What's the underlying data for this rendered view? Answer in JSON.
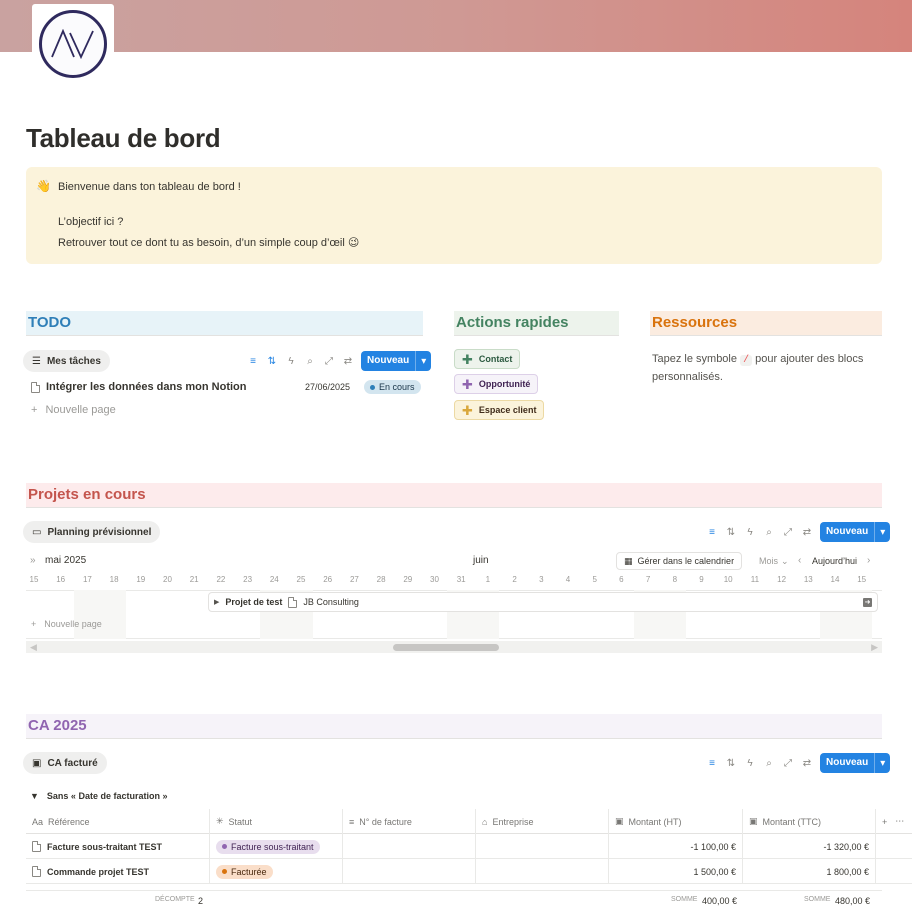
{
  "page": {
    "title": "Tableau de bord",
    "callout": {
      "emoji": "👋",
      "line1": "Bienvenue dans ton tableau de bord !",
      "line2": "L’objectif ici ?",
      "line3": "Retrouver tout ce dont tu as besoin, d’un simple coup d’œil 😉"
    }
  },
  "todo": {
    "heading": "TODO",
    "view": "Mes tâches",
    "new_label": "Nouveau",
    "task": {
      "title": "Intégrer les données dans mon Notion",
      "date": "27/06/2025",
      "status": "En cours"
    },
    "new_page": "Nouvelle page"
  },
  "actions": {
    "heading": "Actions rapides",
    "buttons": [
      {
        "label": "Contact",
        "color": "#448361"
      },
      {
        "label": "Opportunité",
        "color": "#9065b0"
      },
      {
        "label": "Espace client",
        "color": "#d9a73b"
      }
    ]
  },
  "resources": {
    "heading": "Ressources",
    "text_before": "Tapez le symbole",
    "symbol": "/",
    "text_after": "pour ajouter des blocs personnalisés."
  },
  "projects": {
    "heading": "Projets en cours",
    "view": "Planning prévisionnel",
    "new_label": "Nouveau",
    "month_left": "mai 2025",
    "month_mid": "juin",
    "manage_calendar": "Gérer dans le calendrier",
    "period": "Mois",
    "today": "Aujourd’hui",
    "days": [
      "15",
      "16",
      "17",
      "18",
      "19",
      "20",
      "21",
      "22",
      "23",
      "24",
      "25",
      "26",
      "27",
      "28",
      "29",
      "30",
      "31",
      "1",
      "2",
      "3",
      "4",
      "5",
      "6",
      "7",
      "8",
      "9",
      "10",
      "11",
      "12",
      "13",
      "14",
      "15"
    ],
    "item": {
      "name": "Projet de test",
      "client": "JB Consulting"
    },
    "new_page": "Nouvelle page"
  },
  "ca": {
    "heading": "CA 2025",
    "view": "CA facturé",
    "new_label": "Nouveau",
    "group": "Sans « Date de facturation »",
    "columns": [
      "Référence",
      "Statut",
      "N° de facture",
      "Entreprise",
      "Montant (HT)",
      "Montant (TTC)"
    ],
    "rows": [
      {
        "ref": "Facture sous-traitant TEST",
        "status": "Facture sous-traitant",
        "status_color": "#9065b0",
        "ht": "-1 100,00 €",
        "ttc": "-1 320,00 €"
      },
      {
        "ref": "Commande projet TEST",
        "status": "Facturée",
        "status_color": "#d9730d",
        "ht": "1 500,00 €",
        "ttc": "1 800,00 €"
      }
    ],
    "footer": {
      "count_label": "DÉCOMPTE",
      "count": "2",
      "sum_label": "SOMME",
      "sum_ht": "400,00 €",
      "sum_ttc": "480,00 €"
    }
  },
  "colors": {
    "todo": "#2f7fb8",
    "actions": "#448361",
    "resources": "#d9730d",
    "projects": "#c4554d",
    "ca": "#9065b0",
    "accent": "#2383e2"
  }
}
